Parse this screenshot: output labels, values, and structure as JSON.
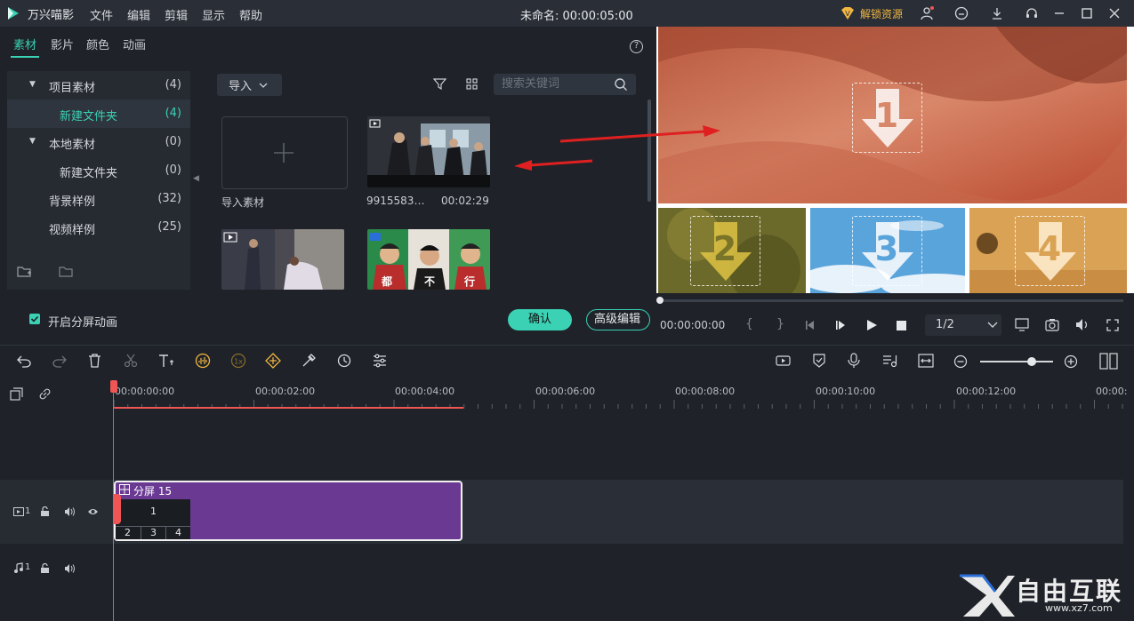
{
  "app": {
    "name": "万兴喵影",
    "project_title": "未命名: 00:00:05:00",
    "unlock": "解锁资源"
  },
  "menu": [
    "文件",
    "编辑",
    "剪辑",
    "显示",
    "帮助"
  ],
  "tabs": [
    "素材",
    "影片",
    "颜色",
    "动画"
  ],
  "tree": [
    {
      "label": "项目素材",
      "count": "(4)"
    },
    {
      "label": "新建文件夹",
      "count": "(4)"
    },
    {
      "label": "本地素材",
      "count": "(0)"
    },
    {
      "label": "新建文件夹",
      "count": "(0)"
    },
    {
      "label": "背景样例",
      "count": "(32)"
    },
    {
      "label": "视频样例",
      "count": "(25)"
    }
  ],
  "media": {
    "import_label": "导入",
    "search_placeholder": "搜索关键词",
    "import_tile_label": "导入素材",
    "clip1_name": "9915583…",
    "clip1_duration": "00:02:29",
    "clip3_captions": [
      "都",
      "不",
      "行"
    ]
  },
  "footer": {
    "split_anim": "开启分屏动画",
    "confirm": "确认",
    "advanced": "高级编辑"
  },
  "preview": {
    "zones": [
      "1",
      "2",
      "3",
      "4"
    ],
    "timecode": "00:00:00:00",
    "braces": [
      "{",
      "}"
    ],
    "ratio": "1/2"
  },
  "ruler": [
    "00:00:00:00",
    "00:00:02:00",
    "00:00:04:00",
    "00:00:06:00",
    "00:00:08:00",
    "00:00:10:00",
    "00:00:12:00",
    "00:00:"
  ],
  "timeline": {
    "clip_title": "分屏 15",
    "clip_cells": [
      "1",
      "2",
      "3",
      "4"
    ],
    "video_track": "1",
    "audio_track": "1"
  },
  "watermark": {
    "text": "自由互联",
    "url": "www.xz7.com"
  },
  "colors": {
    "accent": "#3ad1b4",
    "clip": "#6a3a93",
    "playhead": "#f05555",
    "unlock": "#f2b640",
    "annotation": "#e02020"
  }
}
